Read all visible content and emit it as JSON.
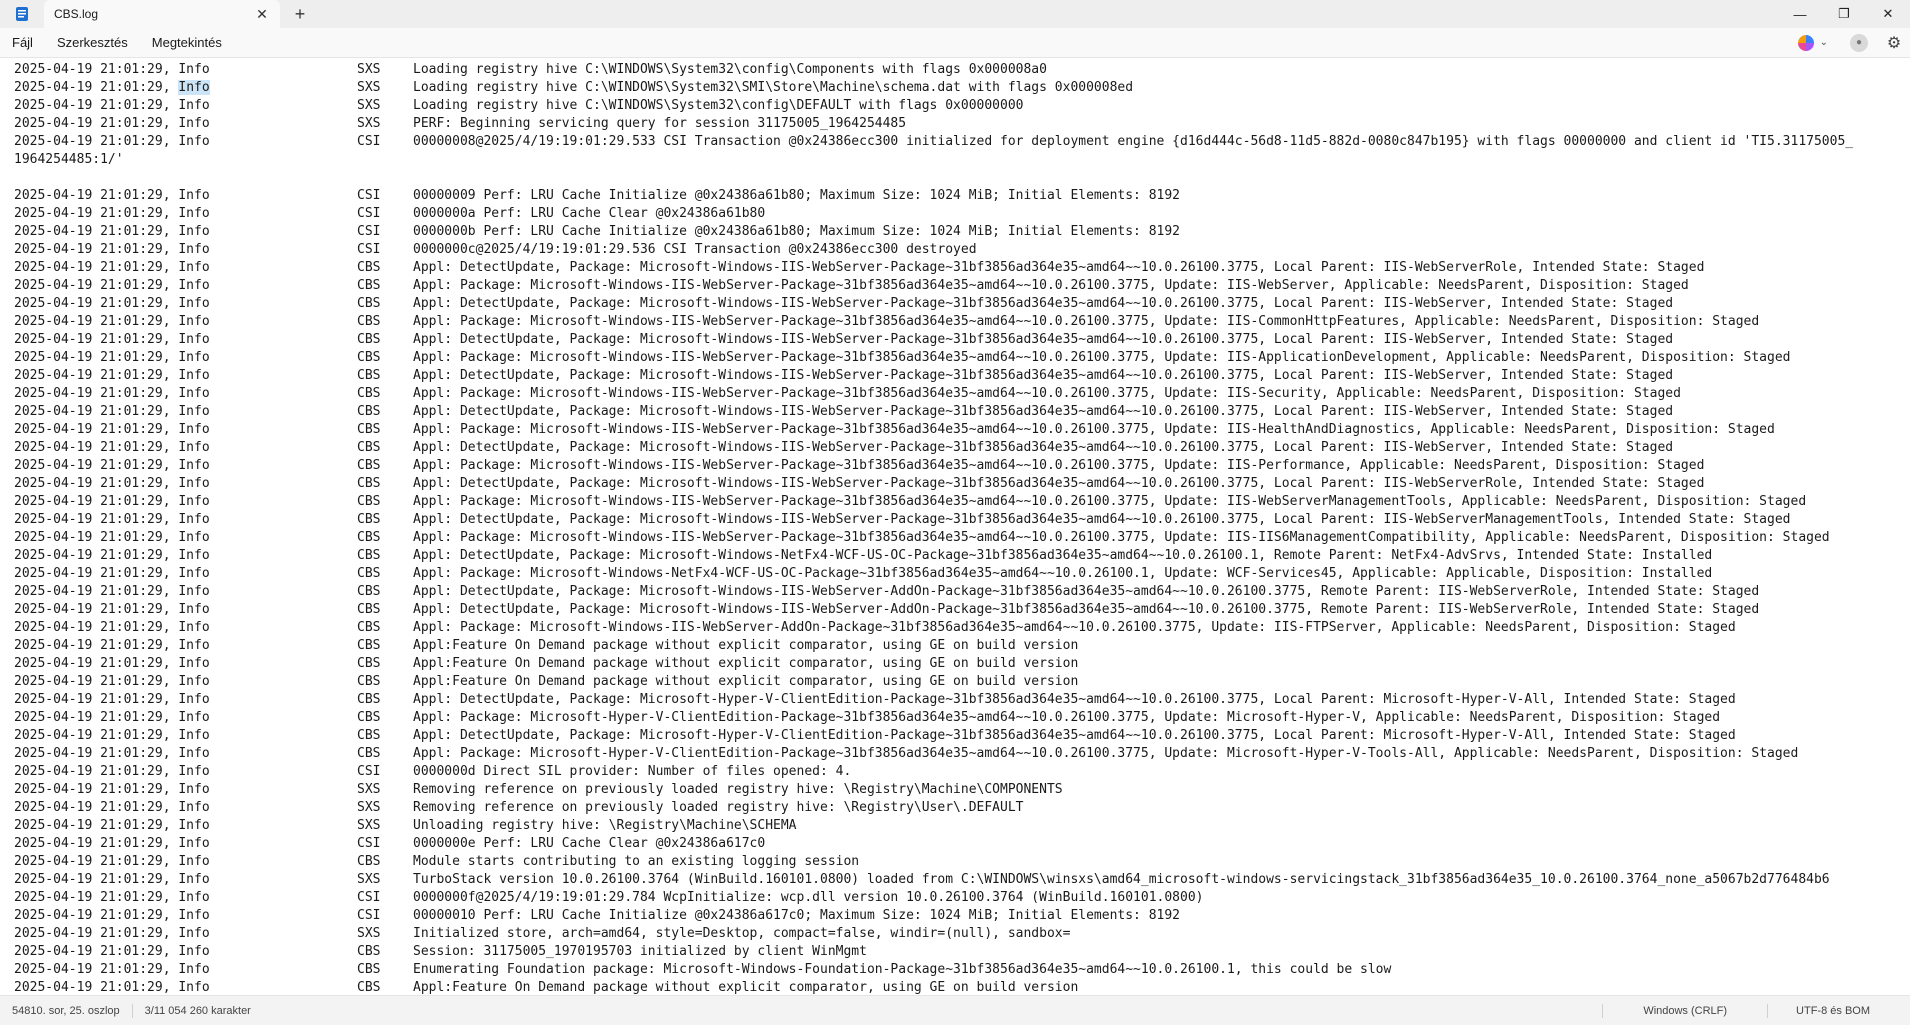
{
  "app": {
    "tab_title": "CBS.log",
    "new_tab": "+",
    "tab_close": "✕"
  },
  "window_controls": {
    "minimize": "—",
    "maximize": "❐",
    "close": "✕"
  },
  "menu": {
    "file": "Fájl",
    "edit": "Szerkesztés",
    "view": "Megtekintés"
  },
  "icons": {
    "app": "notepad-icon",
    "copilot": "copilot-icon",
    "account": "account-icon",
    "settings": "gear-icon"
  },
  "lines": [
    [
      "2025-04-19 21:01:29, Info",
      "SXS",
      "Loading registry hive C:\\WINDOWS\\System32\\config\\Components with flags 0x000008a0"
    ],
    [
      "2025-04-19 21:01:29, Info",
      "SXS",
      "Loading registry hive C:\\WINDOWS\\System32\\SMI\\Store\\Machine\\schema.dat with flags 0x000008ed"
    ],
    [
      "2025-04-19 21:01:29, Info",
      "SXS",
      "Loading registry hive C:\\WINDOWS\\System32\\config\\DEFAULT with flags 0x00000000"
    ],
    [
      "2025-04-19 21:01:29, Info",
      "SXS",
      "PERF: Beginning servicing query for session 31175005_1964254485"
    ],
    [
      "2025-04-19 21:01:29, Info",
      "CSI",
      "00000008@2025/4/19:19:01:29.533 CSI Transaction @0x24386ecc300 initialized for deployment engine {d16d444c-56d8-11d5-882d-0080c847b195} with flags 00000000 and client id 'TI5.31175005_"
    ],
    [
      "1964254485:1/'",
      "",
      ""
    ],
    [
      "",
      "",
      ""
    ],
    [
      "2025-04-19 21:01:29, Info",
      "CSI",
      "00000009 Perf: LRU Cache Initialize @0x24386a61b80; Maximum Size: 1024 MiB; Initial Elements: 8192"
    ],
    [
      "2025-04-19 21:01:29, Info",
      "CSI",
      "0000000a Perf: LRU Cache Clear @0x24386a61b80"
    ],
    [
      "2025-04-19 21:01:29, Info",
      "CSI",
      "0000000b Perf: LRU Cache Initialize @0x24386a61b80; Maximum Size: 1024 MiB; Initial Elements: 8192"
    ],
    [
      "2025-04-19 21:01:29, Info",
      "CSI",
      "0000000c@2025/4/19:19:01:29.536 CSI Transaction @0x24386ecc300 destroyed"
    ],
    [
      "2025-04-19 21:01:29, Info",
      "CBS",
      "Appl: DetectUpdate, Package: Microsoft-Windows-IIS-WebServer-Package~31bf3856ad364e35~amd64~~10.0.26100.3775, Local Parent: IIS-WebServerRole, Intended State: Staged"
    ],
    [
      "2025-04-19 21:01:29, Info",
      "CBS",
      "Appl: Package: Microsoft-Windows-IIS-WebServer-Package~31bf3856ad364e35~amd64~~10.0.26100.3775, Update: IIS-WebServer, Applicable: NeedsParent, Disposition: Staged"
    ],
    [
      "2025-04-19 21:01:29, Info",
      "CBS",
      "Appl: DetectUpdate, Package: Microsoft-Windows-IIS-WebServer-Package~31bf3856ad364e35~amd64~~10.0.26100.3775, Local Parent: IIS-WebServer, Intended State: Staged"
    ],
    [
      "2025-04-19 21:01:29, Info",
      "CBS",
      "Appl: Package: Microsoft-Windows-IIS-WebServer-Package~31bf3856ad364e35~amd64~~10.0.26100.3775, Update: IIS-CommonHttpFeatures, Applicable: NeedsParent, Disposition: Staged"
    ],
    [
      "2025-04-19 21:01:29, Info",
      "CBS",
      "Appl: DetectUpdate, Package: Microsoft-Windows-IIS-WebServer-Package~31bf3856ad364e35~amd64~~10.0.26100.3775, Local Parent: IIS-WebServer, Intended State: Staged"
    ],
    [
      "2025-04-19 21:01:29, Info",
      "CBS",
      "Appl: Package: Microsoft-Windows-IIS-WebServer-Package~31bf3856ad364e35~amd64~~10.0.26100.3775, Update: IIS-ApplicationDevelopment, Applicable: NeedsParent, Disposition: Staged"
    ],
    [
      "2025-04-19 21:01:29, Info",
      "CBS",
      "Appl: DetectUpdate, Package: Microsoft-Windows-IIS-WebServer-Package~31bf3856ad364e35~amd64~~10.0.26100.3775, Local Parent: IIS-WebServer, Intended State: Staged"
    ],
    [
      "2025-04-19 21:01:29, Info",
      "CBS",
      "Appl: Package: Microsoft-Windows-IIS-WebServer-Package~31bf3856ad364e35~amd64~~10.0.26100.3775, Update: IIS-Security, Applicable: NeedsParent, Disposition: Staged"
    ],
    [
      "2025-04-19 21:01:29, Info",
      "CBS",
      "Appl: DetectUpdate, Package: Microsoft-Windows-IIS-WebServer-Package~31bf3856ad364e35~amd64~~10.0.26100.3775, Local Parent: IIS-WebServer, Intended State: Staged"
    ],
    [
      "2025-04-19 21:01:29, Info",
      "CBS",
      "Appl: Package: Microsoft-Windows-IIS-WebServer-Package~31bf3856ad364e35~amd64~~10.0.26100.3775, Update: IIS-HealthAndDiagnostics, Applicable: NeedsParent, Disposition: Staged"
    ],
    [
      "2025-04-19 21:01:29, Info",
      "CBS",
      "Appl: DetectUpdate, Package: Microsoft-Windows-IIS-WebServer-Package~31bf3856ad364e35~amd64~~10.0.26100.3775, Local Parent: IIS-WebServer, Intended State: Staged"
    ],
    [
      "2025-04-19 21:01:29, Info",
      "CBS",
      "Appl: Package: Microsoft-Windows-IIS-WebServer-Package~31bf3856ad364e35~amd64~~10.0.26100.3775, Update: IIS-Performance, Applicable: NeedsParent, Disposition: Staged"
    ],
    [
      "2025-04-19 21:01:29, Info",
      "CBS",
      "Appl: DetectUpdate, Package: Microsoft-Windows-IIS-WebServer-Package~31bf3856ad364e35~amd64~~10.0.26100.3775, Local Parent: IIS-WebServerRole, Intended State: Staged"
    ],
    [
      "2025-04-19 21:01:29, Info",
      "CBS",
      "Appl: Package: Microsoft-Windows-IIS-WebServer-Package~31bf3856ad364e35~amd64~~10.0.26100.3775, Update: IIS-WebServerManagementTools, Applicable: NeedsParent, Disposition: Staged"
    ],
    [
      "2025-04-19 21:01:29, Info",
      "CBS",
      "Appl: DetectUpdate, Package: Microsoft-Windows-IIS-WebServer-Package~31bf3856ad364e35~amd64~~10.0.26100.3775, Local Parent: IIS-WebServerManagementTools, Intended State: Staged"
    ],
    [
      "2025-04-19 21:01:29, Info",
      "CBS",
      "Appl: Package: Microsoft-Windows-IIS-WebServer-Package~31bf3856ad364e35~amd64~~10.0.26100.3775, Update: IIS-IIS6ManagementCompatibility, Applicable: NeedsParent, Disposition: Staged"
    ],
    [
      "2025-04-19 21:01:29, Info",
      "CBS",
      "Appl: DetectUpdate, Package: Microsoft-Windows-NetFx4-WCF-US-OC-Package~31bf3856ad364e35~amd64~~10.0.26100.1, Remote Parent: NetFx4-AdvSrvs, Intended State: Installed"
    ],
    [
      "2025-04-19 21:01:29, Info",
      "CBS",
      "Appl: Package: Microsoft-Windows-NetFx4-WCF-US-OC-Package~31bf3856ad364e35~amd64~~10.0.26100.1, Update: WCF-Services45, Applicable: Applicable, Disposition: Installed"
    ],
    [
      "2025-04-19 21:01:29, Info",
      "CBS",
      "Appl: DetectUpdate, Package: Microsoft-Windows-IIS-WebServer-AddOn-Package~31bf3856ad364e35~amd64~~10.0.26100.3775, Remote Parent: IIS-WebServerRole, Intended State: Staged"
    ],
    [
      "2025-04-19 21:01:29, Info",
      "CBS",
      "Appl: DetectUpdate, Package: Microsoft-Windows-IIS-WebServer-AddOn-Package~31bf3856ad364e35~amd64~~10.0.26100.3775, Remote Parent: IIS-WebServerRole, Intended State: Staged"
    ],
    [
      "2025-04-19 21:01:29, Info",
      "CBS",
      "Appl: Package: Microsoft-Windows-IIS-WebServer-AddOn-Package~31bf3856ad364e35~amd64~~10.0.26100.3775, Update: IIS-FTPServer, Applicable: NeedsParent, Disposition: Staged"
    ],
    [
      "2025-04-19 21:01:29, Info",
      "CBS",
      "Appl:Feature On Demand package without explicit comparator, using GE on build version"
    ],
    [
      "2025-04-19 21:01:29, Info",
      "CBS",
      "Appl:Feature On Demand package without explicit comparator, using GE on build version"
    ],
    [
      "2025-04-19 21:01:29, Info",
      "CBS",
      "Appl:Feature On Demand package without explicit comparator, using GE on build version"
    ],
    [
      "2025-04-19 21:01:29, Info",
      "CBS",
      "Appl: DetectUpdate, Package: Microsoft-Hyper-V-ClientEdition-Package~31bf3856ad364e35~amd64~~10.0.26100.3775, Local Parent: Microsoft-Hyper-V-All, Intended State: Staged"
    ],
    [
      "2025-04-19 21:01:29, Info",
      "CBS",
      "Appl: Package: Microsoft-Hyper-V-ClientEdition-Package~31bf3856ad364e35~amd64~~10.0.26100.3775, Update: Microsoft-Hyper-V, Applicable: NeedsParent, Disposition: Staged"
    ],
    [
      "2025-04-19 21:01:29, Info",
      "CBS",
      "Appl: DetectUpdate, Package: Microsoft-Hyper-V-ClientEdition-Package~31bf3856ad364e35~amd64~~10.0.26100.3775, Local Parent: Microsoft-Hyper-V-All, Intended State: Staged"
    ],
    [
      "2025-04-19 21:01:29, Info",
      "CBS",
      "Appl: Package: Microsoft-Hyper-V-ClientEdition-Package~31bf3856ad364e35~amd64~~10.0.26100.3775, Update: Microsoft-Hyper-V-Tools-All, Applicable: NeedsParent, Disposition: Staged"
    ],
    [
      "2025-04-19 21:01:29, Info",
      "CSI",
      "0000000d Direct SIL provider: Number of files opened: 4."
    ],
    [
      "2025-04-19 21:01:29, Info",
      "SXS",
      "Removing reference on previously loaded registry hive: \\Registry\\Machine\\COMPONENTS"
    ],
    [
      "2025-04-19 21:01:29, Info",
      "SXS",
      "Removing reference on previously loaded registry hive: \\Registry\\User\\.DEFAULT"
    ],
    [
      "2025-04-19 21:01:29, Info",
      "SXS",
      "Unloading registry hive: \\Registry\\Machine\\SCHEMA"
    ],
    [
      "2025-04-19 21:01:29, Info",
      "CSI",
      "0000000e Perf: LRU Cache Clear @0x24386a617c0"
    ],
    [
      "2025-04-19 21:01:29, Info",
      "CBS",
      "Module starts contributing to an existing logging session"
    ],
    [
      "2025-04-19 21:01:29, Info",
      "SXS",
      "TurboStack version 10.0.26100.3764 (WinBuild.160101.0800) loaded from C:\\WINDOWS\\winsxs\\amd64_microsoft-windows-servicingstack_31bf3856ad364e35_10.0.26100.3764_none_a5067b2d776484b6"
    ],
    [
      "2025-04-19 21:01:29, Info",
      "CSI",
      "0000000f@2025/4/19:19:01:29.784 WcpInitialize: wcp.dll version 10.0.26100.3764 (WinBuild.160101.0800)"
    ],
    [
      "2025-04-19 21:01:29, Info",
      "CSI",
      "00000010 Perf: LRU Cache Initialize @0x24386a617c0; Maximum Size: 1024 MiB; Initial Elements: 8192"
    ],
    [
      "2025-04-19 21:01:29, Info",
      "SXS",
      "Initialized store, arch=amd64, style=Desktop, compact=false, windir=(null), sandbox="
    ],
    [
      "2025-04-19 21:01:29, Info",
      "CBS",
      "Session: 31175005_1970195703 initialized by client WinMgmt"
    ],
    [
      "2025-04-19 21:01:29, Info",
      "CBS",
      "Enumerating Foundation package: Microsoft-Windows-Foundation-Package~31bf3856ad364e35~amd64~~10.0.26100.1, this could be slow"
    ],
    [
      "2025-04-19 21:01:29, Info",
      "CBS",
      "Appl:Feature On Demand package without explicit comparator, using GE on build version"
    ]
  ],
  "selection": {
    "line_index": 1,
    "selected_text": "Info"
  },
  "status": {
    "position": "54810. sor, 25. oszlop",
    "characters": "3/11 054 260 karakter",
    "line_ending": "Windows (CRLF)",
    "encoding": "UTF-8 és BOM"
  }
}
